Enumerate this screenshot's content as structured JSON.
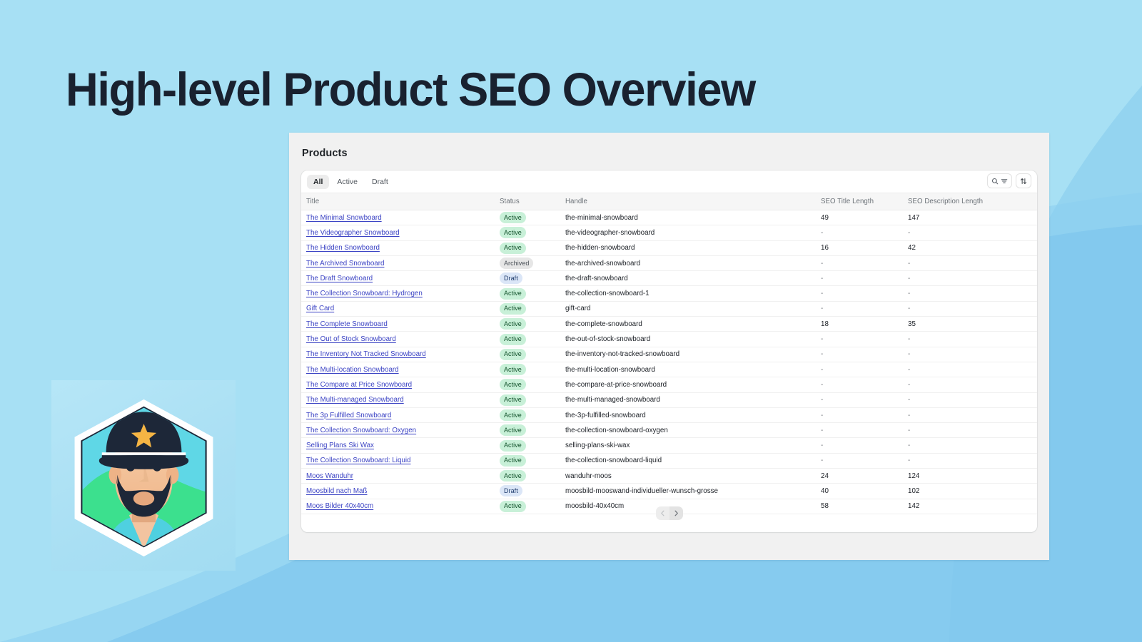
{
  "page": {
    "hero_title": "High-level Product SEO Overview",
    "background_color": "#a7e0f4",
    "title_color": "#19212f",
    "accent_swoosh_color": "#7dc4ec"
  },
  "avatar": {
    "name": "captain-mascot-badge",
    "hat_color": "#1d2738",
    "star_color": "#f5b544",
    "skin_color": "#f0b990",
    "backdrop_green": "#3de08f",
    "backdrop_teal": "#5ad4e0"
  },
  "panel": {
    "title": "Products"
  },
  "card": {
    "tabs": [
      {
        "label": "All",
        "selected": true
      },
      {
        "label": "Active",
        "selected": false
      },
      {
        "label": "Draft",
        "selected": false
      }
    ],
    "actions": [
      {
        "name": "search-filter-button",
        "icons": [
          "search-icon",
          "filter-icon"
        ]
      },
      {
        "name": "sort-button",
        "icons": [
          "sort-arrows-icon"
        ]
      }
    ],
    "columns": [
      "Title",
      "Status",
      "Handle",
      "SEO Title Length",
      "SEO Description Length"
    ],
    "rows": [
      {
        "title": "The Minimal Snowboard",
        "status": "Active",
        "handle": "the-minimal-snowboard",
        "seo_title_length": "49",
        "seo_description_length": "147"
      },
      {
        "title": "The Videographer Snowboard",
        "status": "Active",
        "handle": "the-videographer-snowboard",
        "seo_title_length": "-",
        "seo_description_length": "-"
      },
      {
        "title": "The Hidden Snowboard",
        "status": "Active",
        "handle": "the-hidden-snowboard",
        "seo_title_length": "16",
        "seo_description_length": "42"
      },
      {
        "title": "The Archived Snowboard",
        "status": "Archived",
        "handle": "the-archived-snowboard",
        "seo_title_length": "-",
        "seo_description_length": "-"
      },
      {
        "title": "The Draft Snowboard",
        "status": "Draft",
        "handle": "the-draft-snowboard",
        "seo_title_length": "-",
        "seo_description_length": "-"
      },
      {
        "title": "The Collection Snowboard: Hydrogen",
        "status": "Active",
        "handle": "the-collection-snowboard-1",
        "seo_title_length": "-",
        "seo_description_length": "-"
      },
      {
        "title": "Gift Card",
        "status": "Active",
        "handle": "gift-card",
        "seo_title_length": "-",
        "seo_description_length": "-"
      },
      {
        "title": "The Complete Snowboard",
        "status": "Active",
        "handle": "the-complete-snowboard",
        "seo_title_length": "18",
        "seo_description_length": "35"
      },
      {
        "title": "The Out of Stock Snowboard",
        "status": "Active",
        "handle": "the-out-of-stock-snowboard",
        "seo_title_length": "-",
        "seo_description_length": "-"
      },
      {
        "title": "The Inventory Not Tracked Snowboard",
        "status": "Active",
        "handle": "the-inventory-not-tracked-snowboard",
        "seo_title_length": "-",
        "seo_description_length": "-"
      },
      {
        "title": "The Multi-location Snowboard",
        "status": "Active",
        "handle": "the-multi-location-snowboard",
        "seo_title_length": "-",
        "seo_description_length": "-"
      },
      {
        "title": "The Compare at Price Snowboard",
        "status": "Active",
        "handle": "the-compare-at-price-snowboard",
        "seo_title_length": "-",
        "seo_description_length": "-"
      },
      {
        "title": "The Multi-managed Snowboard",
        "status": "Active",
        "handle": "the-multi-managed-snowboard",
        "seo_title_length": "-",
        "seo_description_length": "-"
      },
      {
        "title": "The 3p Fulfilled Snowboard",
        "status": "Active",
        "handle": "the-3p-fulfilled-snowboard",
        "seo_title_length": "-",
        "seo_description_length": "-"
      },
      {
        "title": "The Collection Snowboard: Oxygen",
        "status": "Active",
        "handle": "the-collection-snowboard-oxygen",
        "seo_title_length": "-",
        "seo_description_length": "-"
      },
      {
        "title": "Selling Plans Ski Wax",
        "status": "Active",
        "handle": "selling-plans-ski-wax",
        "seo_title_length": "-",
        "seo_description_length": "-"
      },
      {
        "title": "The Collection Snowboard: Liquid",
        "status": "Active",
        "handle": "the-collection-snowboard-liquid",
        "seo_title_length": "-",
        "seo_description_length": "-"
      },
      {
        "title": "Moos Wanduhr",
        "status": "Active",
        "handle": "wanduhr-moos",
        "seo_title_length": "24",
        "seo_description_length": "124"
      },
      {
        "title": "Moosbild nach Maß",
        "status": "Draft",
        "handle": "moosbild-mooswand-individueller-wunsch-grosse",
        "seo_title_length": "40",
        "seo_description_length": "102"
      },
      {
        "title": "Moos Bilder 40x40cm",
        "status": "Active",
        "handle": "moosbild-40x40cm",
        "seo_title_length": "58",
        "seo_description_length": "142"
      }
    ],
    "pagination": {
      "prev_label": "‹",
      "next_label": "›",
      "prev_enabled": false,
      "next_enabled": true
    }
  },
  "status_colors": {
    "Active": "#c8f0d8",
    "Draft": "#dbe6f7",
    "Archived": "#e6e6e6"
  }
}
